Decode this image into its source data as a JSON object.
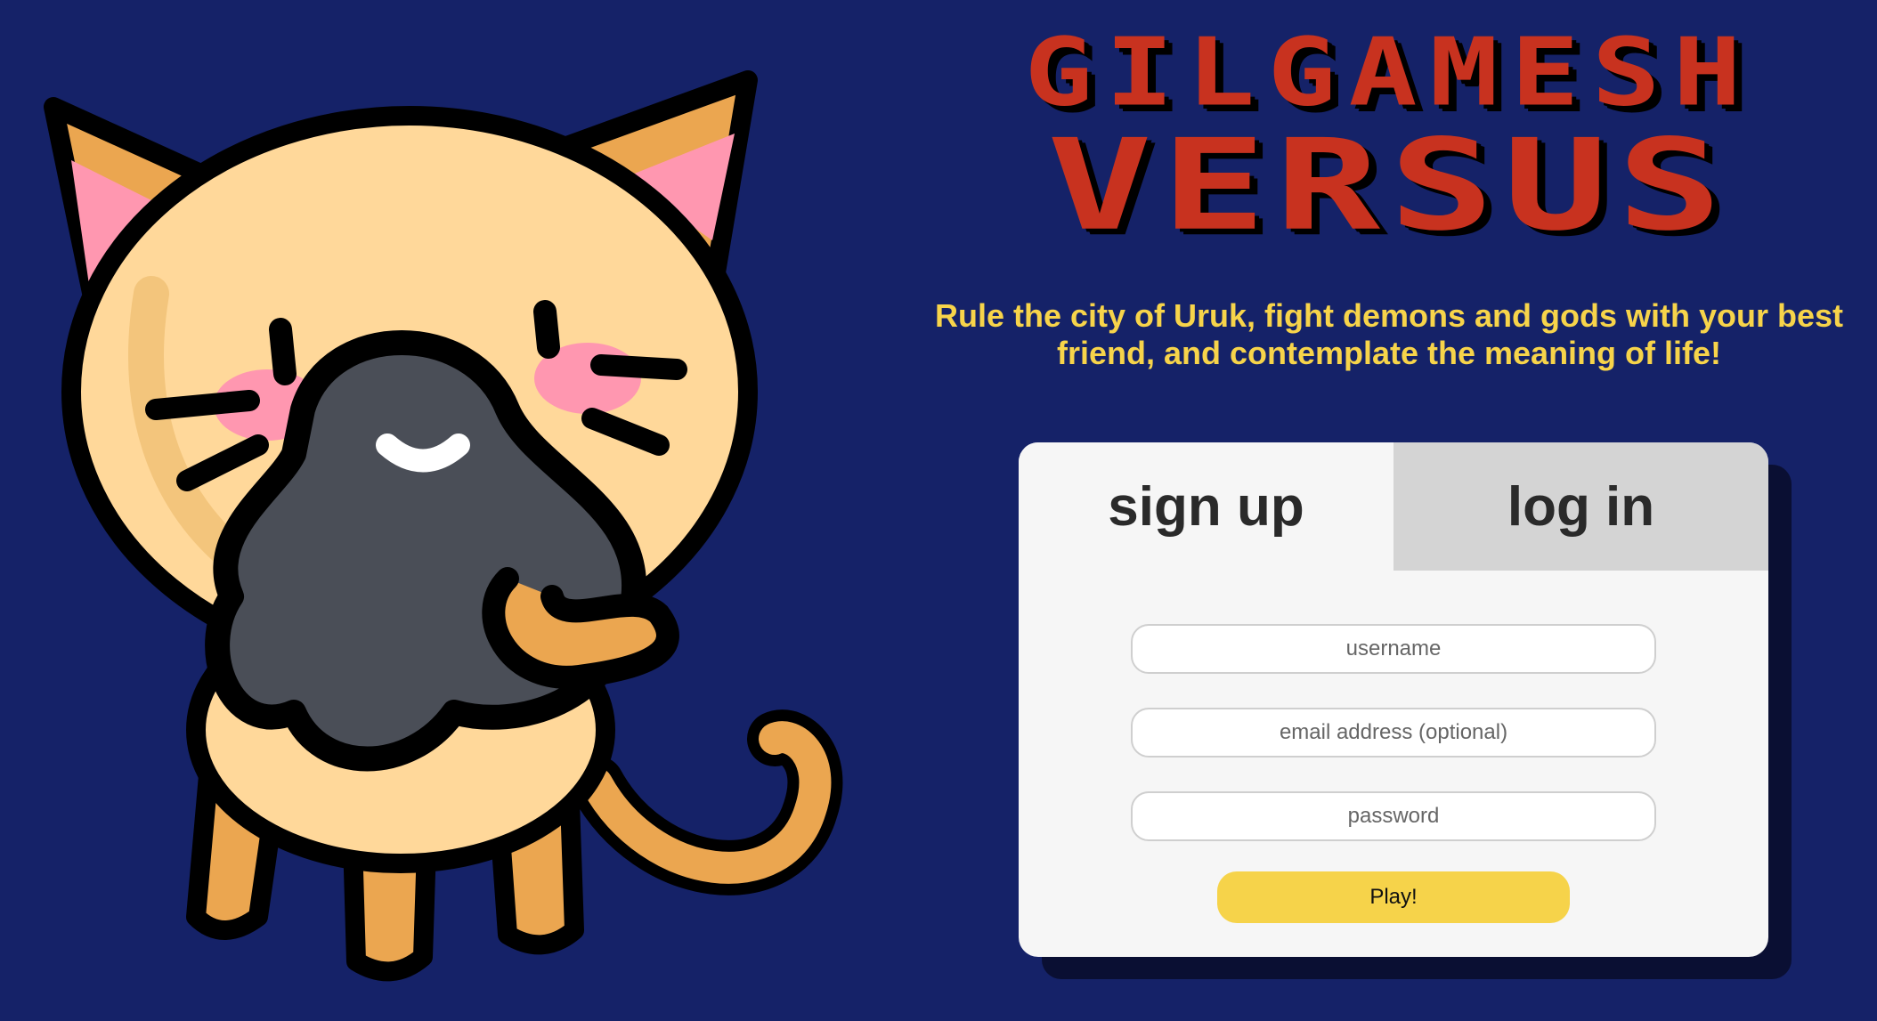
{
  "title": {
    "line1": "GILGAMESH",
    "line2": "VERSUS"
  },
  "tagline": "Rule the city of Uruk, fight demons and gods with your best friend, and contemplate the meaning of life!",
  "auth": {
    "tabs": [
      {
        "label": "sign up",
        "active": true
      },
      {
        "label": "log in",
        "active": false
      }
    ],
    "fields": {
      "username_placeholder": "username",
      "email_placeholder": "email address (optional)",
      "password_placeholder": "password"
    },
    "submit_label": "Play!"
  },
  "colors": {
    "background": "#152268",
    "title_red": "#c8321f",
    "tagline_yellow": "#f7d44a",
    "button_yellow": "#f6d34a",
    "card": "#f6f6f6",
    "inactive_tab": "#d4d4d4"
  },
  "icons": {
    "mascot": "cat-mascot-holding-ball"
  }
}
